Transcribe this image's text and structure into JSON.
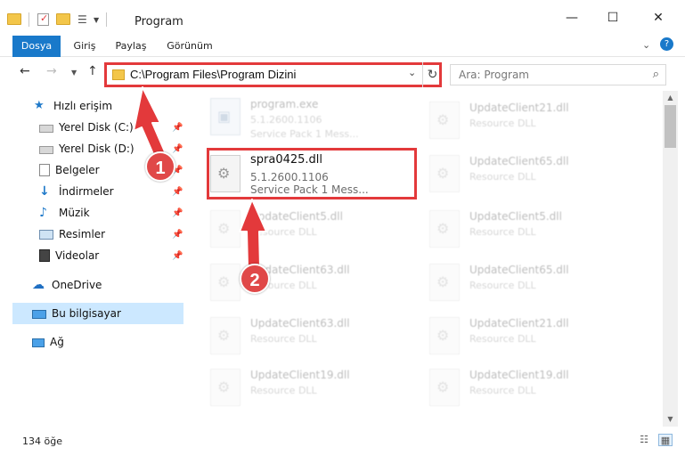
{
  "window": {
    "title": "Program",
    "controls": {
      "minimize": "—",
      "maximize": "☐",
      "close": "✕"
    }
  },
  "ribbon": {
    "tabs": [
      {
        "label": "Dosya",
        "active": true
      },
      {
        "label": "Giriş"
      },
      {
        "label": "Paylaş"
      },
      {
        "label": "Görünüm"
      }
    ],
    "collapse_icon": "chevron-down-icon",
    "help_icon": "help-icon"
  },
  "nav": {
    "back_icon": "back-arrow-icon",
    "forward_icon": "forward-arrow-icon",
    "recent_icon": "chevron-down-icon",
    "up_icon": "up-arrow-icon",
    "address": "C:\\Program Files\\Program Dizini",
    "search_placeholder": "Ara: Program"
  },
  "sidebar": {
    "items": [
      {
        "label": "Hızlı erişim",
        "icon": "star-icon",
        "pinned": false
      },
      {
        "label": "Yerel Disk (C:)",
        "icon": "drive-icon",
        "pinned": true
      },
      {
        "label": "Yerel Disk (D:)",
        "icon": "drive-icon",
        "pinned": true
      },
      {
        "label": "Belgeler",
        "icon": "document-icon",
        "pinned": true
      },
      {
        "label": "İndirmeler",
        "icon": "download-icon",
        "pinned": true
      },
      {
        "label": "Müzik",
        "icon": "music-icon",
        "pinned": true
      },
      {
        "label": "Resimler",
        "icon": "pictures-icon",
        "pinned": true
      },
      {
        "label": "Videolar",
        "icon": "video-icon",
        "pinned": true
      },
      {
        "label": "OneDrive",
        "icon": "cloud-icon",
        "pinned": false
      },
      {
        "label": "Bu bilgisayar",
        "icon": "computer-icon",
        "pinned": false,
        "selected": true
      },
      {
        "label": "Ağ",
        "icon": "network-icon",
        "pinned": false
      }
    ]
  },
  "files": [
    {
      "name": "program.exe",
      "line1": "5.1.2600.1106",
      "line2": "Service Pack 1 Mess...",
      "type": "exe",
      "faded": true
    },
    {
      "name": "UpdateClient21.dll",
      "line1": "Resource DLL",
      "line2": "",
      "faded": true
    },
    {
      "name": "spra0425.dll",
      "line1": "5.1.2600.1106",
      "line2": "Service Pack 1 Mess...",
      "faded": false,
      "highlighted": true
    },
    {
      "name": "UpdateClient65.dll",
      "line1": "Resource DLL",
      "line2": "",
      "faded": true
    },
    {
      "name": "UpdateClient5.dll",
      "line1": "Resource DLL",
      "line2": "",
      "faded": true
    },
    {
      "name": "UpdateClient5.dll",
      "line1": "Resource DLL",
      "line2": "",
      "faded": true
    },
    {
      "name": "UpdateClient63.dll",
      "line1": "Resource DLL",
      "line2": "",
      "faded": true
    },
    {
      "name": "UpdateClient65.dll",
      "line1": "Resource DLL",
      "line2": "",
      "faded": true
    },
    {
      "name": "UpdateClient63.dll",
      "line1": "Resource DLL",
      "line2": "",
      "faded": true
    },
    {
      "name": "UpdateClient21.dll",
      "line1": "Resource DLL",
      "line2": "",
      "faded": true
    },
    {
      "name": "UpdateClient19.dll",
      "line1": "Resource DLL",
      "line2": "",
      "faded": true
    },
    {
      "name": "UpdateClient19.dll",
      "line1": "Resource DLL",
      "line2": "",
      "faded": true
    }
  ],
  "status": {
    "item_count": "134 öğe"
  },
  "annotations": {
    "badge1": "1",
    "badge2": "2",
    "color": "#e3393b"
  },
  "colors": {
    "accent": "#1979ca",
    "selection": "#cce8ff",
    "highlight": "#e3393b"
  }
}
